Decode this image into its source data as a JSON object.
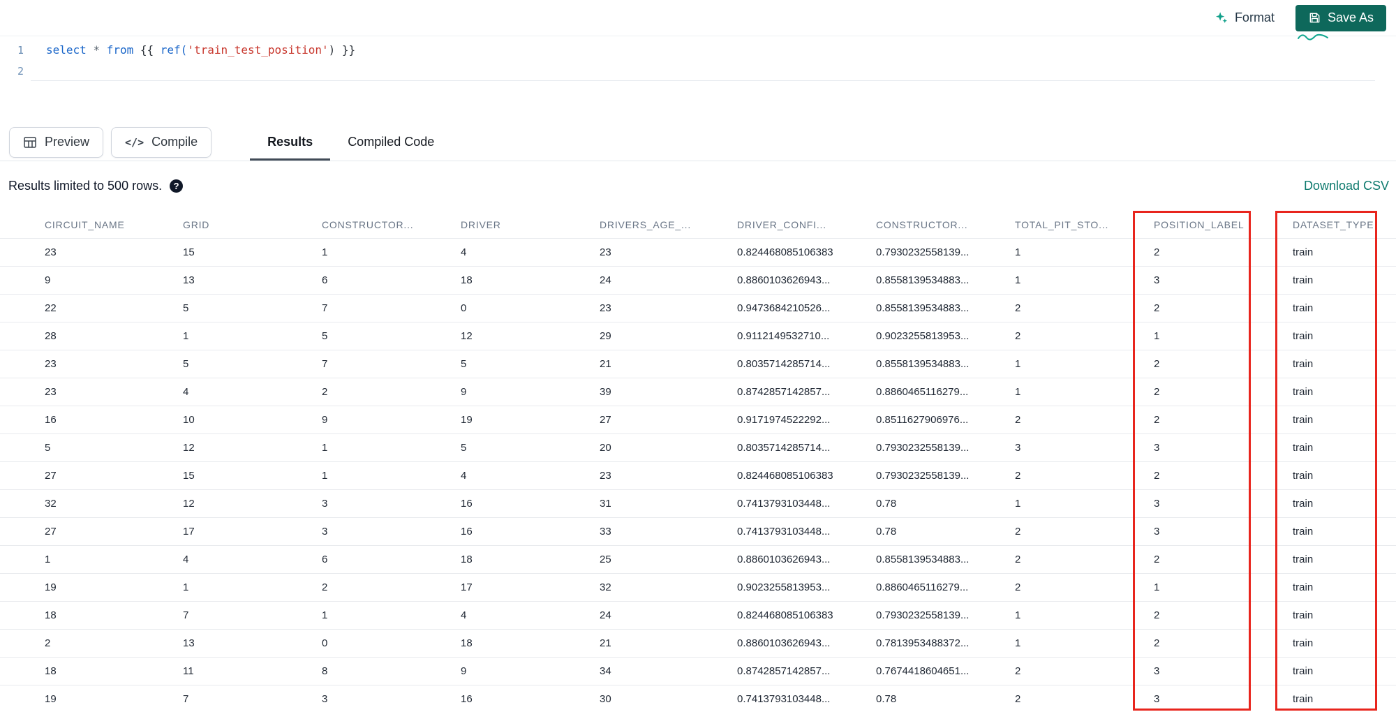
{
  "toolbar": {
    "format": "Format",
    "save_as": "Save As"
  },
  "editor": {
    "lines": [
      {
        "number": "1",
        "tokens": [
          {
            "t": "select",
            "c": "keyword"
          },
          {
            "t": " ",
            "c": "plain"
          },
          {
            "t": "*",
            "c": "operator"
          },
          {
            "t": " ",
            "c": "plain"
          },
          {
            "t": "from",
            "c": "keyword"
          },
          {
            "t": " {{ ",
            "c": "plain"
          },
          {
            "t": "ref(",
            "c": "function"
          },
          {
            "t": "'train_test_position'",
            "c": "string"
          },
          {
            "t": ") }}",
            "c": "plain"
          }
        ]
      },
      {
        "number": "2",
        "tokens": []
      }
    ]
  },
  "actions": {
    "preview": "Preview",
    "compile": "Compile"
  },
  "tabs": [
    {
      "label": "Results",
      "active": true
    },
    {
      "label": "Compiled Code",
      "active": false
    }
  ],
  "results_bar": {
    "limit_text": "Results limited to 500 rows.",
    "download": "Download CSV"
  },
  "table": {
    "columns": [
      "CIRCUIT_NAME",
      "GRID",
      "CONSTRUCTOR...",
      "DRIVER",
      "DRIVERS_AGE_...",
      "DRIVER_CONFI...",
      "CONSTRUCTOR...",
      "TOTAL_PIT_STO...",
      "POSITION_LABEL",
      "DATASET_TYPE"
    ],
    "highlighted_columns": [
      "POSITION_LABEL",
      "DATASET_TYPE"
    ],
    "rows": [
      [
        "23",
        "15",
        "1",
        "4",
        "23",
        "0.824468085106383",
        "0.7930232558139...",
        "1",
        "2",
        "train"
      ],
      [
        "9",
        "13",
        "6",
        "18",
        "24",
        "0.8860103626943...",
        "0.8558139534883...",
        "1",
        "3",
        "train"
      ],
      [
        "22",
        "5",
        "7",
        "0",
        "23",
        "0.9473684210526...",
        "0.8558139534883...",
        "2",
        "2",
        "train"
      ],
      [
        "28",
        "1",
        "5",
        "12",
        "29",
        "0.9112149532710...",
        "0.9023255813953...",
        "2",
        "1",
        "train"
      ],
      [
        "23",
        "5",
        "7",
        "5",
        "21",
        "0.8035714285714...",
        "0.8558139534883...",
        "1",
        "2",
        "train"
      ],
      [
        "23",
        "4",
        "2",
        "9",
        "39",
        "0.8742857142857...",
        "0.8860465116279...",
        "1",
        "2",
        "train"
      ],
      [
        "16",
        "10",
        "9",
        "19",
        "27",
        "0.9171974522292...",
        "0.8511627906976...",
        "2",
        "2",
        "train"
      ],
      [
        "5",
        "12",
        "1",
        "5",
        "20",
        "0.8035714285714...",
        "0.7930232558139...",
        "3",
        "3",
        "train"
      ],
      [
        "27",
        "15",
        "1",
        "4",
        "23",
        "0.824468085106383",
        "0.7930232558139...",
        "2",
        "2",
        "train"
      ],
      [
        "32",
        "12",
        "3",
        "16",
        "31",
        "0.7413793103448...",
        "0.78",
        "1",
        "3",
        "train"
      ],
      [
        "27",
        "17",
        "3",
        "16",
        "33",
        "0.7413793103448...",
        "0.78",
        "2",
        "3",
        "train"
      ],
      [
        "1",
        "4",
        "6",
        "18",
        "25",
        "0.8860103626943...",
        "0.8558139534883...",
        "2",
        "2",
        "train"
      ],
      [
        "19",
        "1",
        "2",
        "17",
        "32",
        "0.9023255813953...",
        "0.8860465116279...",
        "2",
        "1",
        "train"
      ],
      [
        "18",
        "7",
        "1",
        "4",
        "24",
        "0.824468085106383",
        "0.7930232558139...",
        "1",
        "2",
        "train"
      ],
      [
        "2",
        "13",
        "0",
        "18",
        "21",
        "0.8860103626943...",
        "0.7813953488372...",
        "1",
        "2",
        "train"
      ],
      [
        "18",
        "11",
        "8",
        "9",
        "34",
        "0.8742857142857...",
        "0.7674418604651...",
        "2",
        "3",
        "train"
      ],
      [
        "19",
        "7",
        "3",
        "16",
        "30",
        "0.7413793103448...",
        "0.78",
        "2",
        "3",
        "train"
      ]
    ]
  },
  "colors": {
    "accent_teal": "#0E685B",
    "link_teal": "#0E7A6E",
    "highlight_red": "#E8251D"
  }
}
